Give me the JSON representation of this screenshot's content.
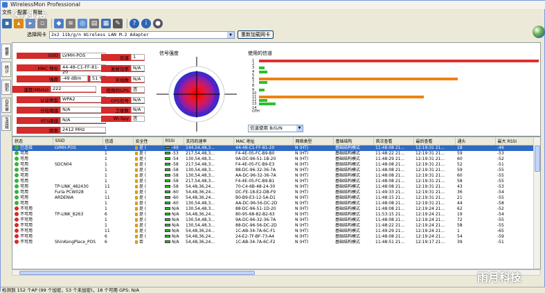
{
  "window": {
    "title": "WirelessMon Professional",
    "watermark": "Ⓢ科技"
  },
  "menu": [
    "文件",
    "配置",
    "帮助"
  ],
  "adapter": {
    "label": "选择网卡",
    "value": "2x2 11b/g/n Wireless LAN M.2 Adapter",
    "refresh": "重新加载网卡"
  },
  "sidetabs": [
    "概要",
    "统计",
    "图形",
    "白名单",
    "IP连接"
  ],
  "info": {
    "ssid_label": "SSID",
    "ssid": "LVMH-POS",
    "mac_label": "MAC 地址",
    "mac": "44-48-C1-FF-81-20",
    "strength_label": "强度",
    "strength_dbm": "-49 dBm",
    "strength_pct": "51 %",
    "speed_label": "速度(Mbits)",
    "speed": "222",
    "auth_label": "认证类型",
    "auth": "WPA2",
    "frag_label": "分段阈值",
    "frag": "N/A",
    "rts_label": "RTS阈值",
    "rts": "N/A",
    "freq_label": "频率",
    "freq": "2412 MHz",
    "channel_label": "信道",
    "channel": "1",
    "txpower_label": "发射功率",
    "txpower": "N/A",
    "antenna_label": "天线数",
    "antenna": "N/A",
    "gps_used_label": "使用的GPS",
    "gps_used": "否",
    "gps_signal_label": "GPS信号",
    "gps_signal": "N/A",
    "sat_label": "卫星数",
    "sat": "N/A",
    "wispy_label": "Wi-Spy",
    "wispy": "否"
  },
  "signal_title": "信号强度",
  "channel_title": "使用的信道",
  "channel_select": "信道使用 B/G/N",
  "channels": [
    {
      "ch": "1",
      "pct": 1.0,
      "color": "#e03030"
    },
    {
      "ch": "2",
      "pct": 0.0,
      "color": "#2ac02a"
    },
    {
      "ch": "3",
      "pct": 0.02,
      "color": "#2ac02a"
    },
    {
      "ch": "4",
      "pct": 0.03,
      "color": "#2ac02a"
    },
    {
      "ch": "5",
      "pct": 0.0,
      "color": "#2ac02a"
    },
    {
      "ch": "6",
      "pct": 0.71,
      "color": "#f08010"
    },
    {
      "ch": "7",
      "pct": 0.03,
      "color": "#2ac02a"
    },
    {
      "ch": "8",
      "pct": 0.0,
      "color": "#2ac02a"
    },
    {
      "ch": "9",
      "pct": 0.02,
      "color": "#2ac02a"
    },
    {
      "ch": "10",
      "pct": 0.0,
      "color": "#2ac02a"
    },
    {
      "ch": "11",
      "pct": 0.59,
      "color": "#f08010"
    },
    {
      "ch": "12",
      "pct": 0.03,
      "color": "#2ac02a"
    },
    {
      "ch": "13",
      "pct": 0.06,
      "color": "#2ac02a"
    },
    {
      "ch": "14",
      "pct": 0.0,
      "color": "#2ac02a"
    },
    {
      "ch": "OTH",
      "pct": 0.0,
      "color": "#2ac02a"
    }
  ],
  "table": {
    "headers": [
      "状态",
      "SSID",
      "信道",
      "安全性",
      "RSSI",
      "支持的速率",
      "MAC 地址",
      "网络类型",
      "基础结构",
      "首次查看",
      "最后查看",
      "通头",
      "最大 RSSI"
    ],
    "rows": [
      {
        "status": "已连接",
        "ok": true,
        "ssid": "LVMH-POS",
        "ch": "1",
        "sec": "是 (",
        "rssi": "-49",
        "rates": "144,54,48,3...",
        "mac": "44-48-C1-FF-81-20",
        "net": "N (HT)",
        "infra": "基础结构模式",
        "first": "11:48:08 21...",
        "last": "12:19:31 21...",
        "hdr": "18",
        "max": "-46",
        "selected": true
      },
      {
        "status": "可用",
        "ok": true,
        "ssid": "",
        "ch": "1",
        "sec": "是 (",
        "rssi": "-53",
        "rates": "217,54,48,3...",
        "mac": "F4-4E-05-FC-B9-B0",
        "net": "N (HT)",
        "infra": "基础结构模式",
        "first": "11:48:22 21...",
        "last": "12:19:31 21...",
        "hdr": "59",
        "max": "-53"
      },
      {
        "status": "可用",
        "ok": true,
        "ssid": "",
        "ch": "1",
        "sec": "是 (",
        "rssi": "-54",
        "rates": "130,54,48,3...",
        "mac": "9A-DC-96-51-1B-20",
        "net": "N (HT)",
        "infra": "基础结构模式",
        "first": "11:48:29 21...",
        "last": "12:19:31 21...",
        "hdr": "60",
        "max": "-52"
      },
      {
        "status": "可用",
        "ok": true,
        "ssid": "SDCN04",
        "ch": "1",
        "sec": "是 (",
        "rssi": "-58",
        "rates": "217,54,48,3...",
        "mac": "F4-4E-05-FC-B9-E3",
        "net": "N (HT)",
        "infra": "基础结构模式",
        "first": "11:48:08 21...",
        "last": "12:19:31 21...",
        "hdr": "52",
        "max": "-51"
      },
      {
        "status": "可用",
        "ok": true,
        "ssid": "",
        "ch": "1",
        "sec": "是 (",
        "rssi": "-58",
        "rates": "130,54,48,3...",
        "mac": "88-DC-96-32-36-7A",
        "net": "N (HT)",
        "infra": "基础结构模式",
        "first": "11:48:08 21...",
        "last": "12:19:31 21...",
        "hdr": "59",
        "max": "-55"
      },
      {
        "status": "可用",
        "ok": true,
        "ssid": "",
        "ch": "1",
        "sec": "是 (",
        "rssi": "-58",
        "rates": "130,54,48,3...",
        "mac": "AA-DC-96-32-36-7A",
        "net": "N (HT)",
        "infra": "基础结构模式",
        "first": "11:48:08 21...",
        "last": "12:19:31 21...",
        "hdr": "60",
        "max": "-55"
      },
      {
        "status": "可用",
        "ok": true,
        "ssid": "",
        "ch": "1",
        "sec": "是 (",
        "rssi": "-58",
        "rates": "217,54,48,3...",
        "mac": "F4-4E-05-FC-B9-B1",
        "net": "N (HT)",
        "infra": "基础结构模式",
        "first": "11:48:08 21...",
        "last": "12:19:31 21...",
        "hdr": "58",
        "max": "-55"
      },
      {
        "status": "可用",
        "ok": true,
        "ssid": "TP-LINK_482430",
        "ch": "11",
        "sec": "是 (",
        "rssi": "-58",
        "rates": "54,48,36,24...",
        "mac": "70-C4-6B-48-24-30",
        "net": "N (HT)",
        "infra": "基础结构模式",
        "first": "11:48:08 21...",
        "last": "12:19:31 21...",
        "hdr": "43",
        "max": "-53"
      },
      {
        "status": "可用",
        "ok": true,
        "ssid": "Furla PCW028",
        "ch": "1",
        "sec": "是 (",
        "rssi": "-60",
        "rates": "54,48,36,24...",
        "mac": "DC-FE-18-E2-DB-F9",
        "net": "N (HT)",
        "infra": "基础结构模式",
        "first": "11:49:33 21...",
        "last": "12:19:31 21...",
        "hdr": "36",
        "max": "-54"
      },
      {
        "status": "可用",
        "ok": true,
        "ssid": "ARDENIA",
        "ch": "11",
        "sec": "是 (",
        "rssi": "-60",
        "rates": "54,48,36,24...",
        "mac": "B0-B9-E3-12-5A-D1",
        "net": "N (HT)",
        "infra": "基础结构模式",
        "first": "11:48:15 21...",
        "last": "12:19:31 21...",
        "hdr": "21",
        "max": "-55"
      },
      {
        "status": "可用",
        "ok": true,
        "ssid": "",
        "ch": "1",
        "sec": "是 (",
        "rssi": "-60",
        "rates": "130,54,48,3...",
        "mac": "AA-DC-96-56-DC-2D",
        "net": "N (HT)",
        "infra": "基础结构模式",
        "first": "11:48:08 21...",
        "last": "12:19:31 21...",
        "hdr": "44",
        "max": "-58"
      },
      {
        "status": "不可用",
        "ok": false,
        "ssid": "",
        "ch": "1",
        "sec": "是 (",
        "rssi": "N/A",
        "rates": "130,54,48,3...",
        "mac": "88-DC-96-51-1D-20",
        "net": "N (HT)",
        "infra": "基础结构模式",
        "first": "11:48:08 21...",
        "last": "12:19:24 21...",
        "hdr": "62",
        "max": "-52"
      },
      {
        "status": "不可用",
        "ok": false,
        "ssid": "TP-LINK_B263",
        "ch": "6",
        "sec": "是 (",
        "rssi": "N/A",
        "rates": "54,48,36,24...",
        "mac": "80-95-68-82-B2-63",
        "net": "N (HT)",
        "infra": "基础结构模式",
        "first": "11:53:15 21...",
        "last": "12:19:24 21...",
        "hdr": "19",
        "max": "-54"
      },
      {
        "status": "不可用",
        "ok": false,
        "ssid": "",
        "ch": "1",
        "sec": "是 (",
        "rssi": "N/A",
        "rates": "130,54,48,3...",
        "mac": "9A-DC-96-32-36-7A",
        "net": "N (HT)",
        "infra": "基础结构模式",
        "first": "11:48:08 21...",
        "last": "12:19:24 21...",
        "hdr": "72",
        "max": "-55"
      },
      {
        "status": "不可用",
        "ok": false,
        "ssid": "",
        "ch": "1",
        "sec": "是 (",
        "rssi": "N/A",
        "rates": "130,54,48,3...",
        "mac": "88-DC-96-56-DC-2D",
        "net": "N (HT)",
        "infra": "基础结构模式",
        "first": "11:48:22 21...",
        "last": "12:19:24 21...",
        "hdr": "58",
        "max": "-55"
      },
      {
        "status": "不可用",
        "ok": false,
        "ssid": "",
        "ch": "11",
        "sec": "是 (",
        "rssi": "N/A",
        "rates": "54,48,36,24...",
        "mac": "1C-AB-34-7A-6C-F1",
        "net": "N (HT)",
        "infra": "基础结构模式",
        "first": "11:49:29 21...",
        "last": "12:19:24 21...",
        "hdr": "1",
        "max": "-65"
      },
      {
        "status": "不可用",
        "ok": false,
        "ssid": "",
        "ch": "6",
        "sec": "是 (",
        "rssi": "N/A",
        "rates": "54,48,36,24...",
        "mac": "24-E2-7F-BF-73-A4",
        "net": "N (HT)",
        "infra": "基础结构模式",
        "first": "11:48:08 21...",
        "last": "12:19:24 21...",
        "hdr": "54",
        "max": "-59"
      },
      {
        "status": "不可用",
        "ok": false,
        "ssid": "ShinKongPlace_POS",
        "ch": "6",
        "sec": "否",
        "rssi": "N/A",
        "rates": "54,48,36,24...",
        "mac": "1C-AB-34-7A-6C-F2",
        "net": "N (HT)",
        "infra": "基础结构模式",
        "first": "11:48:51 21...",
        "last": "12:19:17 21...",
        "hdr": "39",
        "max": "-51"
      }
    ]
  },
  "status": "检测到 152 个AP (99 个加密，53 个未加密)，18 个可用 GPS: N/A",
  "watermark2": "雨月科技"
}
